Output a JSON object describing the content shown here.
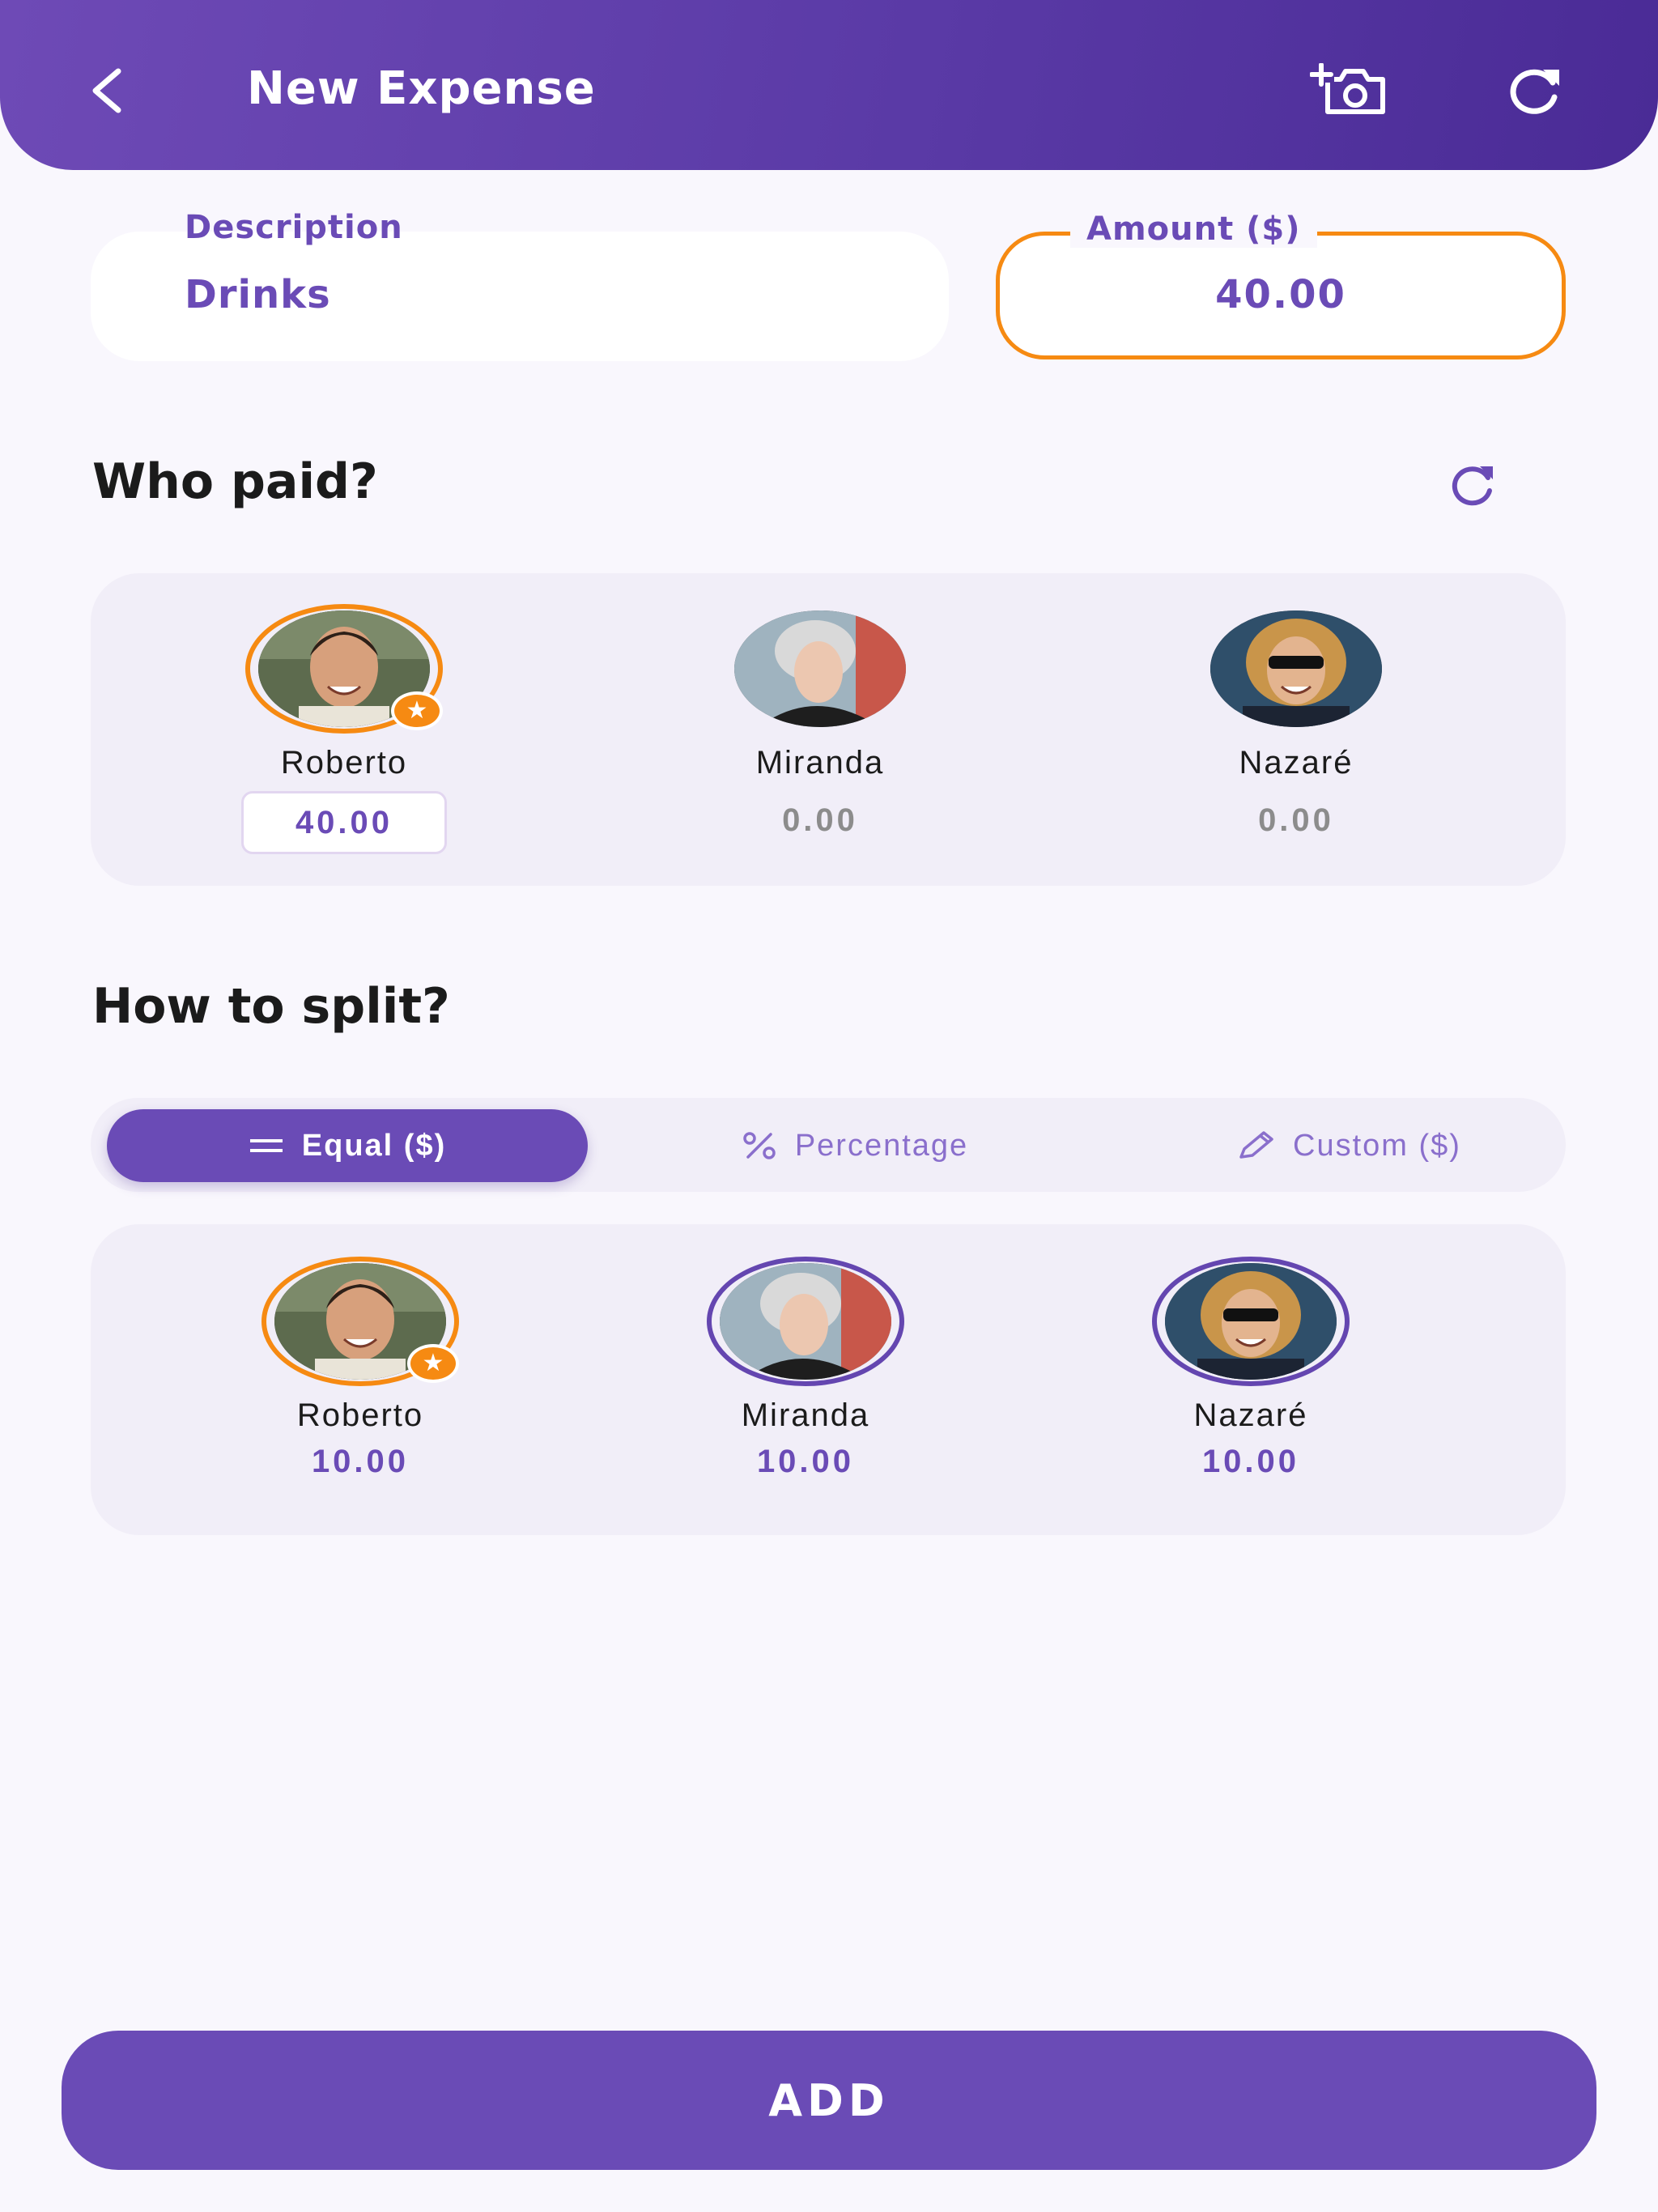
{
  "header": {
    "title": "New Expense",
    "back_icon": "chevron-left-icon",
    "camera_icon": "add-photo-icon",
    "refresh_icon": "refresh-icon"
  },
  "form": {
    "description_label": "Description",
    "description_value": "Drinks",
    "amount_label": "Amount ($)",
    "amount_value": "40.00"
  },
  "who_paid": {
    "heading": "Who paid?",
    "people": [
      {
        "name": "Roberto",
        "amount": "40.00"
      },
      {
        "name": "Miranda",
        "amount": "0.00"
      },
      {
        "name": "Nazaré",
        "amount": "0.00"
      }
    ]
  },
  "split": {
    "heading": "How to split?",
    "tabs": [
      {
        "label": "Equal ($)",
        "icon": "equals-icon"
      },
      {
        "label": "Percentage",
        "icon": "percent-icon"
      },
      {
        "label": "Custom ($)",
        "icon": "pencil-icon"
      }
    ],
    "selected_tab": "Equal ($)",
    "people": [
      {
        "name": "Roberto",
        "amount": "10.00"
      },
      {
        "name": "Miranda",
        "amount": "10.00"
      },
      {
        "name": "Nazaré",
        "amount": "10.00"
      }
    ]
  },
  "footer": {
    "add_label": "ADD"
  },
  "colors": {
    "primary": "#6a4bb6",
    "accent": "#f68a12",
    "card_bg": "#f1eef8",
    "page_bg": "#f9f7fd"
  }
}
